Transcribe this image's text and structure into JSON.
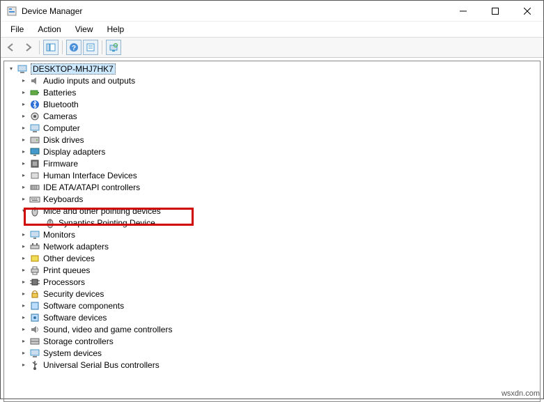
{
  "window": {
    "title": "Device Manager"
  },
  "menubar": {
    "file": "File",
    "action": "Action",
    "view": "View",
    "help": "Help"
  },
  "tree": {
    "root": "DESKTOP-MHJ7HK7",
    "items": [
      {
        "label": "Audio inputs and outputs",
        "expanded": false
      },
      {
        "label": "Batteries",
        "expanded": false
      },
      {
        "label": "Bluetooth",
        "expanded": false
      },
      {
        "label": "Cameras",
        "expanded": false
      },
      {
        "label": "Computer",
        "expanded": false
      },
      {
        "label": "Disk drives",
        "expanded": false
      },
      {
        "label": "Display adapters",
        "expanded": false
      },
      {
        "label": "Firmware",
        "expanded": false
      },
      {
        "label": "Human Interface Devices",
        "expanded": false
      },
      {
        "label": "IDE ATA/ATAPI controllers",
        "expanded": false
      },
      {
        "label": "Keyboards",
        "expanded": false
      },
      {
        "label": "Mice and other pointing devices",
        "expanded": true,
        "highlighted": true,
        "children": [
          {
            "label": "Synaptics Pointing Device"
          }
        ]
      },
      {
        "label": "Monitors",
        "expanded": false
      },
      {
        "label": "Network adapters",
        "expanded": false
      },
      {
        "label": "Other devices",
        "expanded": false
      },
      {
        "label": "Print queues",
        "expanded": false
      },
      {
        "label": "Processors",
        "expanded": false
      },
      {
        "label": "Security devices",
        "expanded": false
      },
      {
        "label": "Software components",
        "expanded": false
      },
      {
        "label": "Software devices",
        "expanded": false
      },
      {
        "label": "Sound, video and game controllers",
        "expanded": false
      },
      {
        "label": "Storage controllers",
        "expanded": false
      },
      {
        "label": "System devices",
        "expanded": false
      },
      {
        "label": "Universal Serial Bus controllers",
        "expanded": false
      }
    ]
  },
  "watermark": "wsxdn.com"
}
